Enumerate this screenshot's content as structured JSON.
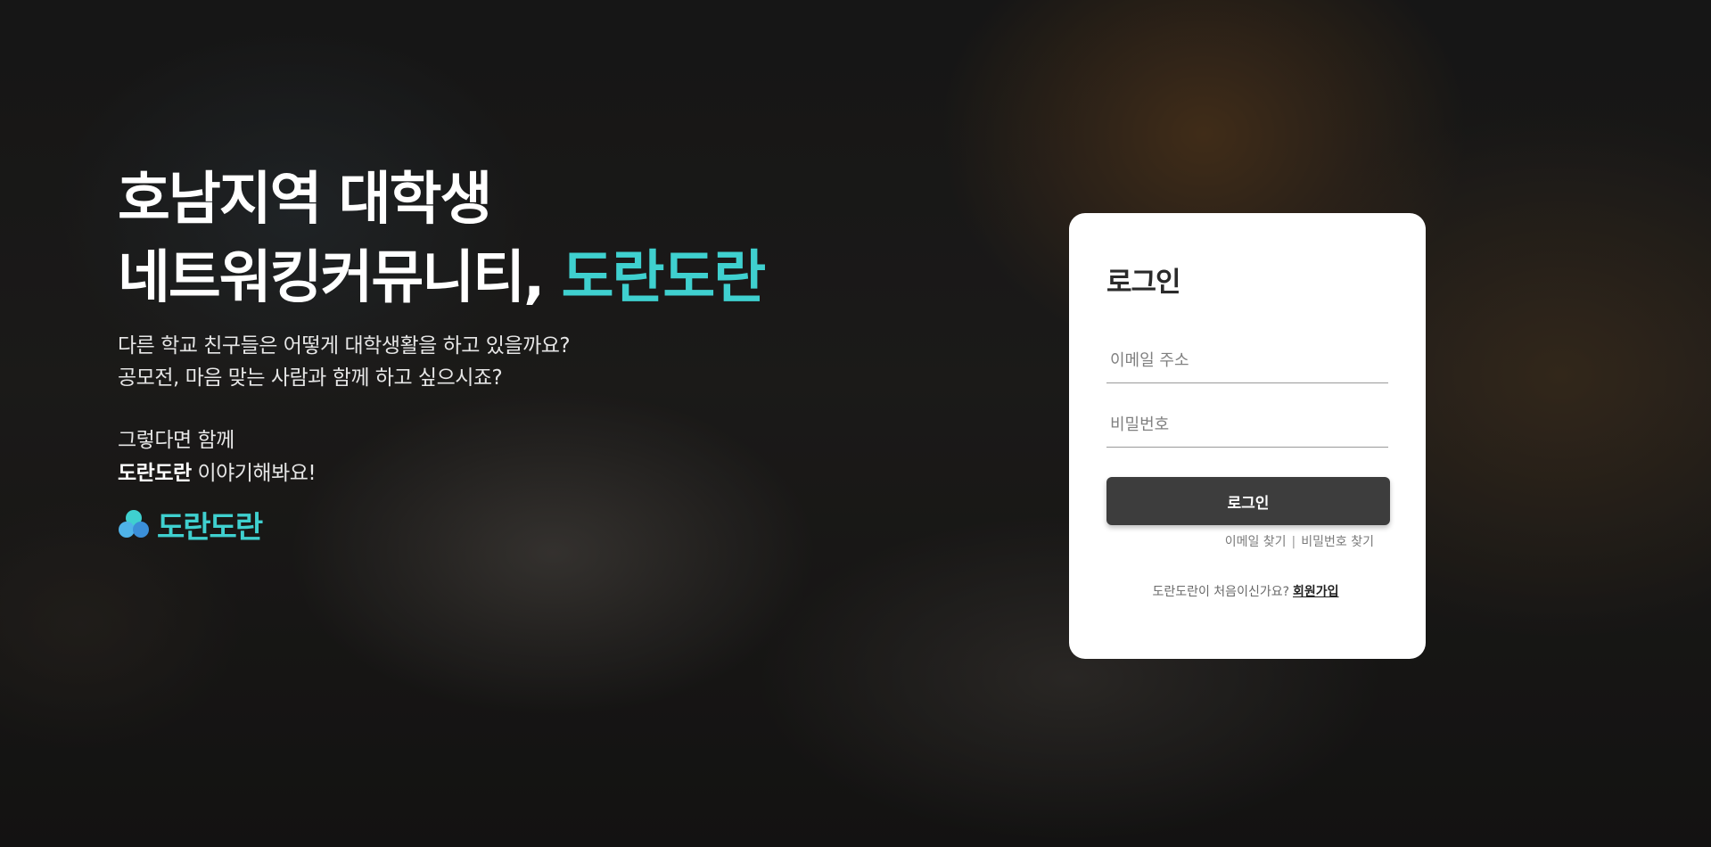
{
  "hero": {
    "title_line1": "호남지역 대학생",
    "title_line2_prefix": "네트워킹커뮤니티, ",
    "title_line2_accent": "도란도란",
    "desc_line1": "다른 학교 친구들은 어떻게 대학생활을 하고 있을까요?",
    "desc_line2": "공모전, 마음 맞는 사람과 함께 하고 싶으시죠?",
    "desc_line3": "그렇다면 함께",
    "desc_line4_bold": "도란도란",
    "desc_line4_rest": " 이야기해봐요!",
    "brand_name": "도란도란",
    "brand_icon": "cloud-cluster-logo-icon"
  },
  "login": {
    "title": "로그인",
    "email_placeholder": "이메일 주소",
    "password_placeholder": "비밀번호",
    "submit_label": "로그인",
    "find_email": "이메일 찾기",
    "separator": "|",
    "find_password": "비밀번호 찾기",
    "signup_prompt": "도란도란이 처음이신가요?",
    "signup_link": "회원가입"
  },
  "colors": {
    "accent": "#3fd0cf",
    "button": "#3d3d3d",
    "card": "#ffffff"
  }
}
